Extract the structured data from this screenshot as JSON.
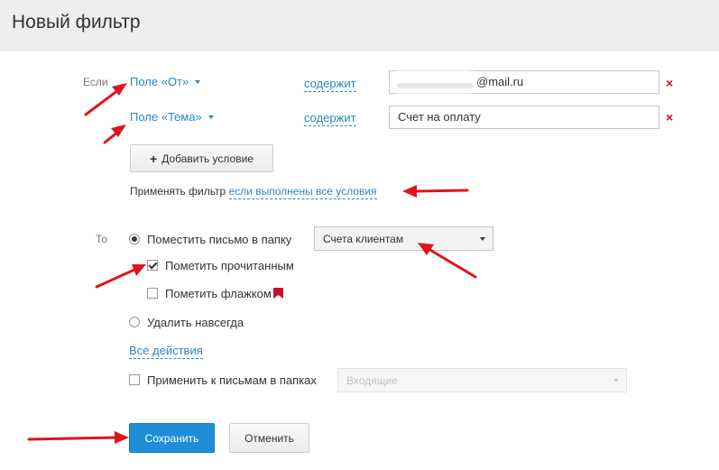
{
  "header": {
    "title": "Новый фильтр"
  },
  "conditions": {
    "if_label": "Если",
    "rows": [
      {
        "field": "Поле «От»",
        "operator": "содержит",
        "value": "@mail.ru"
      },
      {
        "field": "Поле «Тема»",
        "operator": "содержит",
        "value": "Счет на оплату"
      }
    ],
    "add_button": "Добавить условие",
    "apply_prefix": "Применять фильтр",
    "apply_link": "если выполнены все условия"
  },
  "actions": {
    "then_label": "То",
    "move_to_folder": "Поместить письмо в папку",
    "folder_value": "Счета клиентам",
    "mark_read": "Пометить прочитанным",
    "mark_flag": "Пометить флажком",
    "delete_forever": "Удалить навсегда",
    "all_actions": "Все действия",
    "apply_to_folders": "Применить к письмам в папках",
    "folders_placeholder": "Входящие"
  },
  "footer": {
    "save": "Сохранить",
    "cancel": "Отменить"
  },
  "state": {
    "move_to_folder_selected": true,
    "mark_read_checked": true,
    "mark_flag_checked": false,
    "delete_selected": false,
    "apply_to_folders_checked": false
  },
  "colors": {
    "accent": "#2b86c5",
    "primary_button": "#1e8fd6",
    "remove": "#c8102e",
    "flag": "#c8102e",
    "annotation_arrow": "#e0141e"
  }
}
